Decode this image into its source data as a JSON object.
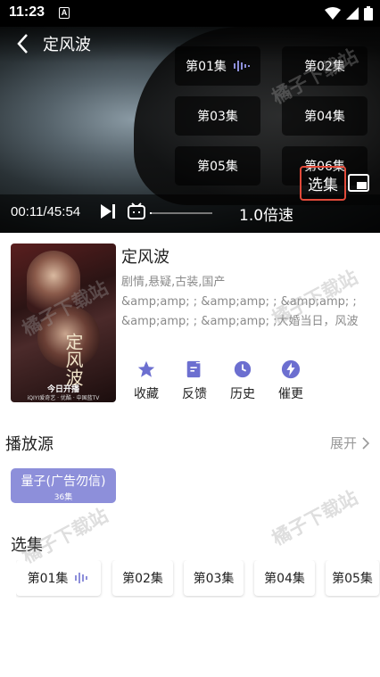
{
  "status_bar": {
    "time": "11:23",
    "badge": "A"
  },
  "player": {
    "title": "定风波",
    "current_time": "00:11/45:54",
    "progress": 0.004,
    "speed_label": "1.0倍速",
    "episodes_label": "选集",
    "episode_overlay": [
      {
        "label": "第01集",
        "playing": true
      },
      {
        "label": "第02集",
        "playing": false
      },
      {
        "label": "第03集",
        "playing": false
      },
      {
        "label": "第04集",
        "playing": false
      },
      {
        "label": "第05集",
        "playing": false
      },
      {
        "label": "第06集",
        "playing": false
      }
    ]
  },
  "info": {
    "title": "定风波",
    "tags": "剧情,悬疑,古装,国产",
    "description": "&amp;amp;    ; &amp;amp;    ; &amp;amp;    ; &amp;amp;    ; &amp;amp;    ;大婚当日，风波湖上，大齐第一神探萧北冥被嫁祸为恶魔夜煞，背负弑…",
    "poster": {
      "logo_text": "定风波",
      "release_text": "今日开播",
      "brands_text": "iQIYI爱奇艺 · 优酷 · 中国蓝TV"
    },
    "actions": [
      {
        "label": "收藏",
        "icon": "star-icon"
      },
      {
        "label": "反馈",
        "icon": "edit-icon"
      },
      {
        "label": "历史",
        "icon": "clock-icon"
      },
      {
        "label": "催更",
        "icon": "bolt-icon"
      }
    ]
  },
  "source_section": {
    "heading": "播放源",
    "expand_label": "展开",
    "source_name": "量子(广告勿信)",
    "source_count": "36集"
  },
  "episode_section": {
    "heading": "选集",
    "items": [
      {
        "label": "第01集",
        "playing": true
      },
      {
        "label": "第02集",
        "playing": false
      },
      {
        "label": "第03集",
        "playing": false
      },
      {
        "label": "第04集",
        "playing": false
      },
      {
        "label": "第05集",
        "playing": false
      }
    ]
  },
  "watermark": "橘子下载站",
  "colors": {
    "accent": "#8d8fda",
    "highlight_border": "#e24a3a",
    "icon": "#6c6fd0"
  }
}
